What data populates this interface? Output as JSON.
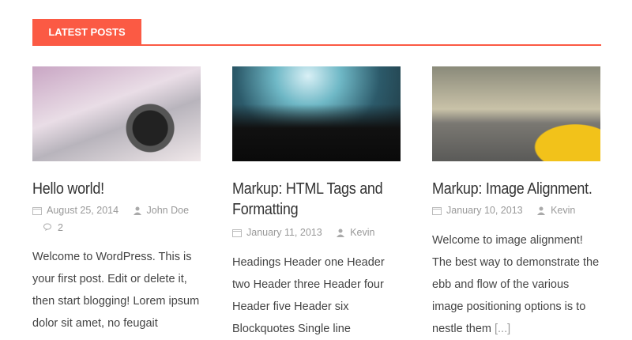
{
  "section_title": "LATEST POSTS",
  "colors": {
    "accent": "#fb5a44"
  },
  "posts": [
    {
      "title": "Hello world!",
      "date": "August 25, 2014",
      "author": "John Doe",
      "comments": "2",
      "excerpt": "Welcome to WordPress. This is your first post. Edit or delete it, then start blogging! Lorem ipsum dolor sit amet, no feugait",
      "more": ""
    },
    {
      "title": "Markup: HTML Tags and Formatting",
      "date": "January 11, 2013",
      "author": "Kevin",
      "excerpt": "Headings Header one Header two Header three Header four Header five Header six Blockquotes Single line",
      "more": ""
    },
    {
      "title": "Markup: Image Alignment.",
      "date": "January 10, 2013",
      "author": "Kevin",
      "excerpt": "Welcome to image alignment! The best way to demonstrate the ebb and flow of the various image positioning options is to nestle them ",
      "more": "[...]"
    }
  ]
}
